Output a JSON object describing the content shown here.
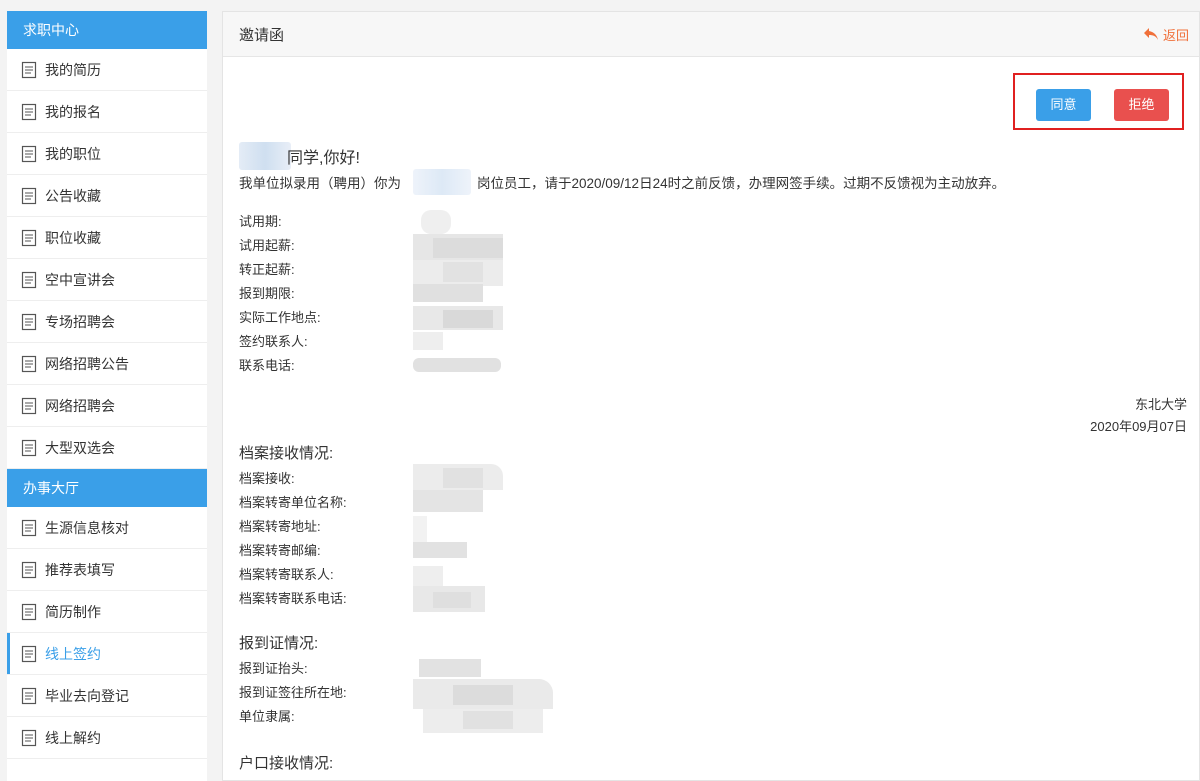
{
  "sidebar": {
    "sections": [
      {
        "title": "求职中心",
        "items": [
          {
            "label": "我的简历",
            "icon": "document-icon"
          },
          {
            "label": "我的报名",
            "icon": "document-icon"
          },
          {
            "label": "我的职位",
            "icon": "document-icon"
          },
          {
            "label": "公告收藏",
            "icon": "document-icon"
          },
          {
            "label": "职位收藏",
            "icon": "document-icon"
          },
          {
            "label": "空中宣讲会",
            "icon": "document-icon"
          },
          {
            "label": "专场招聘会",
            "icon": "document-icon"
          },
          {
            "label": "网络招聘公告",
            "icon": "document-icon"
          },
          {
            "label": "网络招聘会",
            "icon": "document-icon"
          },
          {
            "label": "大型双选会",
            "icon": "document-icon"
          }
        ]
      },
      {
        "title": "办事大厅",
        "items": [
          {
            "label": "生源信息核对",
            "icon": "document-icon"
          },
          {
            "label": "推荐表填写",
            "icon": "document-icon"
          },
          {
            "label": "简历制作",
            "icon": "document-icon"
          },
          {
            "label": "线上签约",
            "icon": "document-icon",
            "active": true
          },
          {
            "label": "毕业去向登记",
            "icon": "document-icon"
          },
          {
            "label": "线上解约",
            "icon": "document-icon"
          }
        ]
      }
    ]
  },
  "header": {
    "title": "邀请函",
    "back_label": "返回"
  },
  "actions": {
    "agree_label": "同意",
    "reject_label": "拒绝"
  },
  "letter": {
    "greeting_suffix": "同学,你好!",
    "body_prefix": "我单位拟录用（聘用）你为",
    "body_suffix": "岗位员工，请于2020/09/12日24时之前反馈，办理网签手续。过期不反馈视为主动放弃。",
    "fields": [
      "试用期:",
      "试用起薪:",
      "转正起薪:",
      "报到期限:",
      "实际工作地点:",
      "签约联系人:",
      "联系电话:"
    ],
    "signature_org": "东北大学",
    "signature_date": "2020年09月07日"
  },
  "archive": {
    "title": "档案接收情况:",
    "fields": [
      "档案接收:",
      "档案转寄单位名称:",
      "档案转寄地址:",
      "档案转寄邮编:",
      "档案转寄联系人:",
      "档案转寄联系电话:"
    ]
  },
  "report": {
    "title": "报到证情况:",
    "fields": [
      "报到证抬头:",
      "报到证签往所在地:",
      "单位隶属:"
    ]
  },
  "household": {
    "title": "户口接收情况:"
  },
  "colors": {
    "primary": "#3a9fe8",
    "danger": "#e9504e",
    "highlight_border": "#e02020",
    "back_link": "#f0703a"
  }
}
